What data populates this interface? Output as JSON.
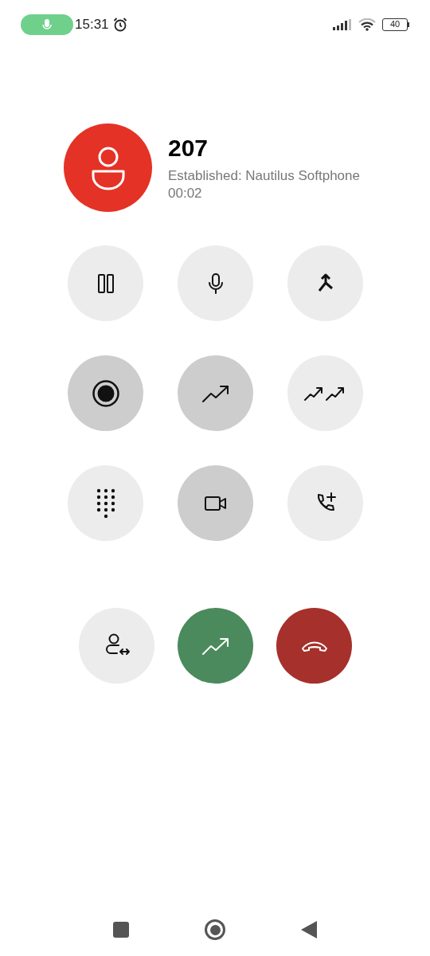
{
  "status_bar": {
    "time": "15:31",
    "battery": "40"
  },
  "call": {
    "number": "207",
    "status": "Established: Nautilus Softphone",
    "duration": "00:02"
  },
  "controls": [
    {
      "kind": "hold",
      "active": false
    },
    {
      "kind": "mute",
      "active": false
    },
    {
      "kind": "merge",
      "active": false
    },
    {
      "kind": "record",
      "active": true
    },
    {
      "kind": "transfer",
      "active": true
    },
    {
      "kind": "attended-transfer",
      "active": false
    },
    {
      "kind": "dialpad",
      "active": false
    },
    {
      "kind": "video",
      "active": true
    },
    {
      "kind": "add-call",
      "active": false
    }
  ],
  "actions": [
    {
      "kind": "contact-swap"
    },
    {
      "kind": "transfer"
    },
    {
      "kind": "hangup"
    }
  ]
}
